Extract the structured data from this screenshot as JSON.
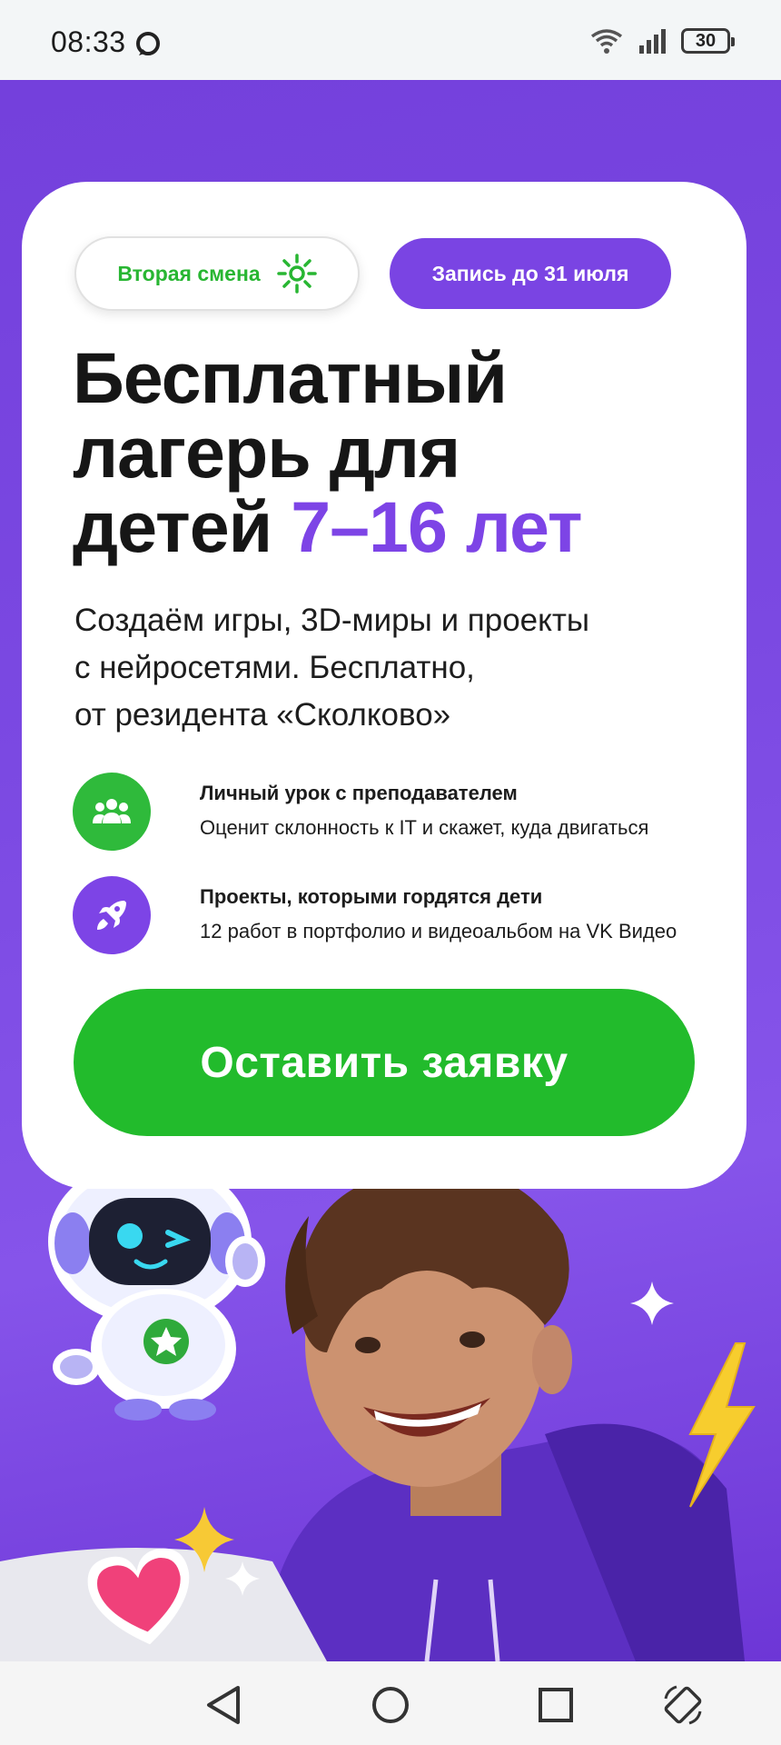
{
  "status_bar": {
    "time": "08:33",
    "battery": "30",
    "icons": [
      "chat-bubble-icon",
      "wifi-icon",
      "signal-icon",
      "battery-icon"
    ]
  },
  "card": {
    "shift_pill": {
      "label": "Вторая смена",
      "icon": "sun-icon"
    },
    "deadline_pill": {
      "label": "Запись до 31 июля"
    },
    "headline": {
      "line1": "Бесплатный",
      "line2": "лагерь для",
      "line3_plain": "детей ",
      "line3_accent": "7–16 лет"
    },
    "subtitle": {
      "line1": "Создаём игры, 3D-миры и проекты",
      "line2": "с нейросетями. Бесплатно,",
      "line3": "от резидента «Сколково»"
    },
    "features": [
      {
        "title": "Личный урок с преподавателем",
        "description": "Оценит склонность к IT и скажет, куда двигаться",
        "icon": "group-icon",
        "color": "#2fba3b"
      },
      {
        "title": "Проекты, которыми гордятся дети",
        "description": "12 работ в портфолио и видеоальбом на VK Видео",
        "icon": "rocket-icon",
        "color": "#7d44e6"
      }
    ],
    "cta_label": "Оставить заявку"
  },
  "colors": {
    "accent_purple": "#7d44e6",
    "accent_green": "#22bb2c",
    "background_purple": "#7a46e0"
  },
  "nav_bar": {
    "icons": [
      "back-icon",
      "home-icon",
      "recents-icon",
      "rotate-icon"
    ]
  }
}
